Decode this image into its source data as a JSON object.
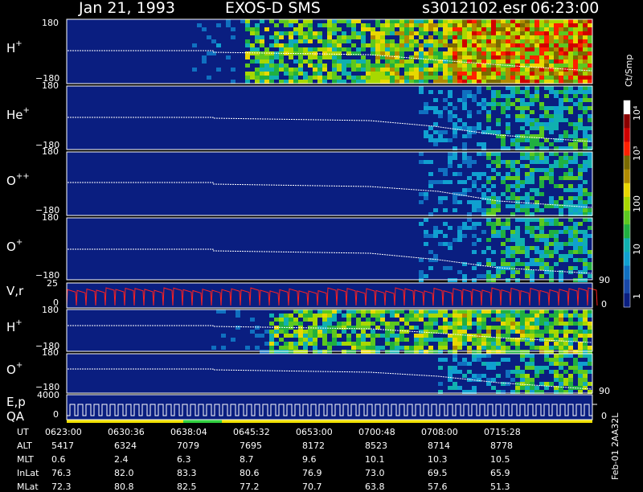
{
  "header": {
    "date": "Jan 21, 1993",
    "instrument": "EXOS-D SMS",
    "file": "s3012102.esr",
    "time": "06:23:00"
  },
  "panels": [
    {
      "id": "h1",
      "label": "H",
      "sup": "+",
      "top_tick": "180",
      "bottom_tick": "−180"
    },
    {
      "id": "he",
      "label": "He",
      "sup": "+",
      "top_tick": "180",
      "bottom_tick": "−180"
    },
    {
      "id": "o2",
      "label": "O",
      "sup": "++",
      "top_tick": "180",
      "bottom_tick": "−180"
    },
    {
      "id": "o1",
      "label": "O",
      "sup": "+",
      "top_tick": "180",
      "bottom_tick": "−180"
    },
    {
      "id": "vr",
      "label": "V,r",
      "sup": "",
      "top_tick": "25",
      "bottom_tick": "0",
      "right_top": "90",
      "right_bottom": "0"
    },
    {
      "id": "h2",
      "label": "H",
      "sup": "+",
      "top_tick": "180",
      "bottom_tick": "−180"
    },
    {
      "id": "o3",
      "label": "O",
      "sup": "+",
      "top_tick": "180",
      "bottom_tick": "−180",
      "right_bottom": "90"
    },
    {
      "id": "ep",
      "label": "E,p",
      "label2": "QA",
      "sup": "",
      "top_tick": "4000",
      "bottom_tick": "0",
      "right_bottom": "0"
    }
  ],
  "colorbar": {
    "unit": "Ct/Smp",
    "labels": [
      "10⁴",
      "10³",
      "100",
      "10",
      "1"
    ],
    "colors": [
      "#ffffff",
      "#8b0000",
      "#d00000",
      "#ff2000",
      "#7a6a00",
      "#b08a00",
      "#e8d800",
      "#a8d800",
      "#5cc820",
      "#20b040",
      "#10b0b0",
      "#10a0d0",
      "#1070c0",
      "#1848a8",
      "#0a1e80"
    ]
  },
  "side_text": "Feb-01 2AA32L",
  "table": {
    "rows": [
      {
        "name": "UT",
        "values": [
          "0623:00",
          "0630:36",
          "0638:04",
          "0645:32",
          "0653:00",
          "0700:48",
          "0708:00",
          "0715:28"
        ]
      },
      {
        "name": "ALT",
        "values": [
          "5417",
          "6324",
          "7079",
          "7695",
          "8172",
          "8523",
          "8714",
          "8778"
        ]
      },
      {
        "name": "MLT",
        "values": [
          "0.6",
          "2.4",
          "6.3",
          "8.7",
          "9.6",
          "10.1",
          "10.3",
          "10.5"
        ]
      },
      {
        "name": "InLat",
        "values": [
          "76.3",
          "82.0",
          "83.3",
          "80.6",
          "76.9",
          "73.0",
          "69.5",
          "65.9"
        ]
      },
      {
        "name": "MLat",
        "values": [
          "72.3",
          "80.8",
          "82.5",
          "77.2",
          "70.7",
          "63.8",
          "57.6",
          "51.3"
        ]
      }
    ]
  },
  "chart_data": {
    "type": "heatmap",
    "title": "Jan 21, 1993   EXOS-D SMS",
    "x_ticks_ut": [
      "0623:00",
      "0630:36",
      "0638:04",
      "0645:32",
      "0653:00",
      "0700:48",
      "0708:00",
      "0715:28"
    ],
    "panels": [
      {
        "name": "H+",
        "ylim": [
          -180,
          180
        ]
      },
      {
        "name": "He+",
        "ylim": [
          -180,
          180
        ]
      },
      {
        "name": "O++",
        "ylim": [
          -180,
          180
        ]
      },
      {
        "name": "O+",
        "ylim": [
          -180,
          180
        ]
      },
      {
        "name": "V,r",
        "ylim": [
          0,
          25
        ],
        "right_ylim": [
          0,
          90
        ]
      },
      {
        "name": "H+",
        "ylim": [
          -180,
          180
        ]
      },
      {
        "name": "O+",
        "ylim": [
          -180,
          180
        ],
        "right_ylim": [
          0,
          90
        ]
      },
      {
        "name": "E,p",
        "ylim": [
          0,
          4000
        ]
      }
    ],
    "colorbar_unit": "Ct/Smp",
    "colorbar_range": [
      1,
      10000
    ],
    "log_scale": true
  }
}
